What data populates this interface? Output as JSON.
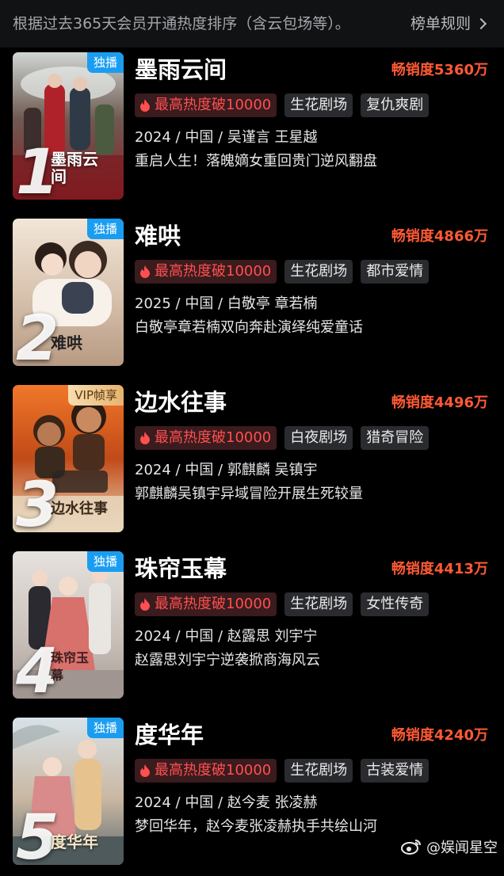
{
  "header": {
    "description": "根据过去365天会员开通热度排序（含云包场等）。",
    "rules_label": "榜单规则"
  },
  "items": [
    {
      "rank": "1",
      "badge": "独播",
      "poster_text": "墨雨云间",
      "title": "墨雨云间",
      "sales": "畅销度5360万",
      "tags": [
        "最高热度破10000",
        "生花剧场",
        "复仇爽剧"
      ],
      "meta": "2024 / 中国 / 吴谨言 王星越",
      "desc": "重启人生！落魄嫡女重回贵门逆风翻盘"
    },
    {
      "rank": "2",
      "badge": "独播",
      "poster_text": "难哄",
      "title": "难哄",
      "sales": "畅销度4866万",
      "tags": [
        "最高热度破10000",
        "生花剧场",
        "都市爱情"
      ],
      "meta": "2025 / 中国 / 白敬亭 章若楠",
      "desc": "白敬亭章若楠双向奔赴演绎纯爱童话"
    },
    {
      "rank": "3",
      "badge": "VIP帧享",
      "poster_text": "边水往事",
      "title": "边水往事",
      "sales": "畅销度4496万",
      "tags": [
        "最高热度破10000",
        "白夜剧场",
        "猎奇冒险"
      ],
      "meta": "2024 / 中国 / 郭麒麟 吴镇宇",
      "desc": "郭麒麟吴镇宇异域冒险开展生死较量"
    },
    {
      "rank": "4",
      "badge": "独播",
      "poster_text": "珠帘玉幕",
      "title": "珠帘玉幕",
      "sales": "畅销度4413万",
      "tags": [
        "最高热度破10000",
        "生花剧场",
        "女性传奇"
      ],
      "meta": "2024 / 中国 / 赵露思 刘宇宁",
      "desc": "赵露思刘宇宁逆袭掀商海风云"
    },
    {
      "rank": "5",
      "badge": "独播",
      "poster_text": "度华年",
      "title": "度华年",
      "sales": "畅销度4240万",
      "tags": [
        "最高热度破10000",
        "生花剧场",
        "古装爱情"
      ],
      "meta": "2024 / 中国 / 赵今麦 张凌赫",
      "desc": "梦回华年，赵今麦张凌赫执手共绘山河"
    }
  ],
  "watermark": "@娱闻星空",
  "colors": {
    "background": "#000000",
    "sales_red": "#ff5a35",
    "hot_red": "#ff4f4f",
    "badge_blue": "#1a9df0"
  }
}
